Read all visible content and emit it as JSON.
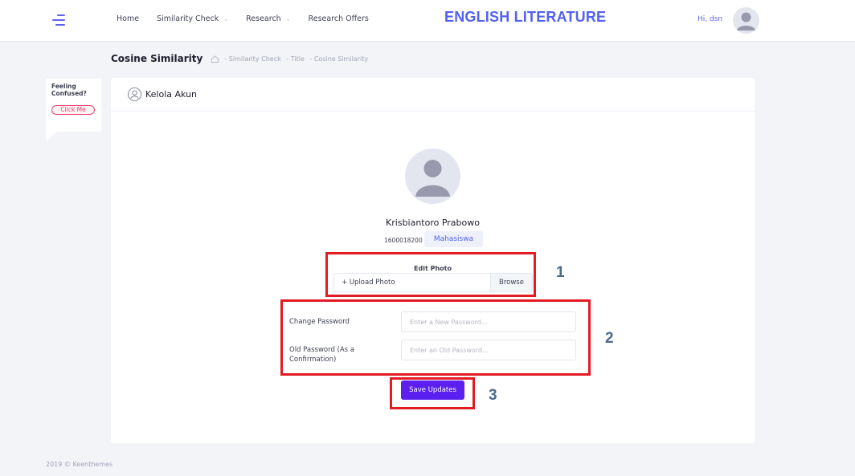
{
  "header": {
    "nav": [
      {
        "label": "Home",
        "has_dropdown": false
      },
      {
        "label": "Similarity Check",
        "has_dropdown": true
      },
      {
        "label": "Research",
        "has_dropdown": true
      },
      {
        "label": "Research Offers",
        "has_dropdown": false
      }
    ],
    "brand": "ENGLISH LITERATURE",
    "greeting": "Hi, dsn"
  },
  "subheader": {
    "title": "Cosine Similarity",
    "breadcrumbs": [
      "- Similarity Check",
      "- Title",
      "- Cosine Similarity"
    ]
  },
  "help": {
    "text": "Feeling Confused?",
    "button": "Click Me"
  },
  "card": {
    "title": "Kelola Akun",
    "profile": {
      "name": "Krisbiantoro Prabowo",
      "nim": "1600018200",
      "role": "Mahasiswa"
    },
    "edit_photo": {
      "label": "Edit Photo",
      "upload_text": "+ Upload Photo",
      "browse_label": "Browse"
    },
    "form": {
      "new_password_label": "Change Password",
      "new_password_placeholder": "Enter a New Password...",
      "old_password_label": "Old Password (As a Confirmation)",
      "old_password_placeholder": "Enter an Old Password..."
    },
    "save_label": "Save Updates"
  },
  "annotations": [
    "1",
    "2",
    "3"
  ],
  "footer": "2019 © Keenthemes",
  "colors": {
    "primary": "#5361f2",
    "save_button": "#5b1ff0",
    "annotation_box": "#e31b23",
    "annotation_number": "#4a6a8f",
    "help_accent": "#f1416c"
  }
}
